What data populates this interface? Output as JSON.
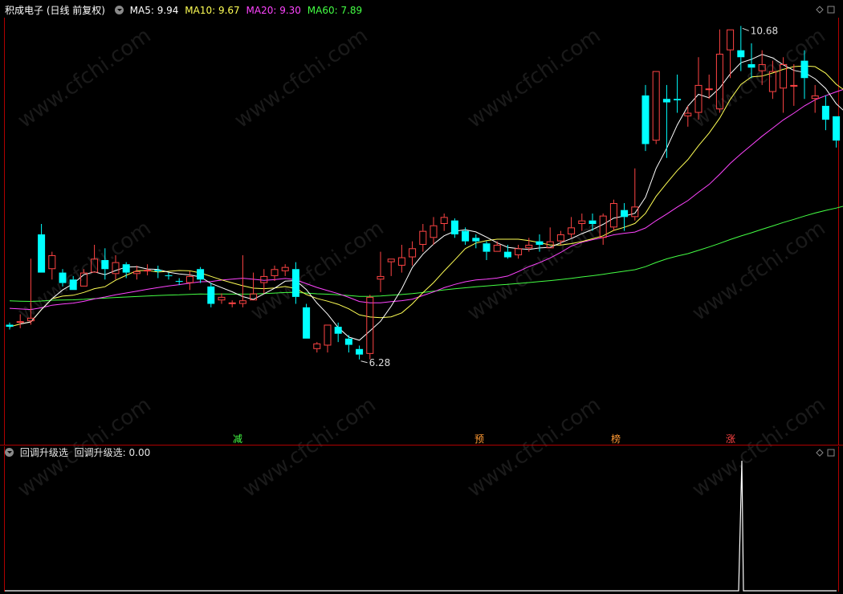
{
  "header": {
    "stock_title": "积成电子 (日线 前复权)",
    "ma5": {
      "label": "MA5: 9.94",
      "color": "#ffffff"
    },
    "ma10": {
      "label": "MA10: 9.67",
      "color": "#ffff55"
    },
    "ma20": {
      "label": "MA20: 9.30",
      "color": "#ff44ff"
    },
    "ma60": {
      "label": "MA60: 7.89",
      "color": "#44ff44"
    }
  },
  "indicator_panel": {
    "title": "回调升级选",
    "value_label": "回调升级选: 0.00"
  },
  "signals": [
    {
      "text": "减",
      "color": "#44ff44"
    },
    {
      "text": "预",
      "color": "#ff9933"
    },
    {
      "text": "榜",
      "color": "#ff9933"
    },
    {
      "text": "涨",
      "color": "#ff4444"
    }
  ],
  "watermark": "www.cfchi.com",
  "colors": {
    "up": "#ff4444",
    "down": "#00ffff",
    "ma5": "#ffffff",
    "ma10": "#ffff55",
    "ma20": "#ff44ff",
    "ma60": "#44ff44",
    "axis": "#b00000"
  },
  "chart_data": {
    "type": "candlestick",
    "ylim": [
      5.5,
      11.3
    ],
    "annotations": {
      "high_label": "10.68",
      "low_label": "6.28"
    },
    "candles": [
      [
        6.95,
        6.92,
        6.88,
        6.98
      ],
      [
        6.99,
        7.0,
        6.9,
        7.1
      ],
      [
        7.0,
        7.05,
        6.95,
        7.9
      ],
      [
        8.25,
        7.7,
        7.7,
        8.4
      ],
      [
        7.75,
        7.95,
        7.6,
        8.0
      ],
      [
        7.7,
        7.55,
        7.5,
        7.75
      ],
      [
        7.6,
        7.45,
        7.45,
        7.65
      ],
      [
        7.5,
        7.7,
        7.5,
        7.75
      ],
      [
        7.7,
        7.9,
        7.7,
        8.1
      ],
      [
        7.88,
        7.75,
        7.6,
        8.05
      ],
      [
        7.68,
        7.85,
        7.6,
        7.95
      ],
      [
        7.82,
        7.7,
        7.62,
        7.85
      ],
      [
        7.68,
        7.72,
        7.6,
        7.8
      ],
      [
        7.72,
        7.74,
        7.66,
        7.82
      ],
      [
        7.74,
        7.72,
        7.62,
        7.8
      ],
      [
        7.66,
        7.65,
        7.6,
        7.7
      ],
      [
        7.58,
        7.57,
        7.52,
        7.62
      ],
      [
        7.55,
        7.65,
        7.45,
        7.72
      ],
      [
        7.75,
        7.6,
        7.55,
        7.78
      ],
      [
        7.5,
        7.25,
        7.2,
        7.55
      ],
      [
        7.3,
        7.35,
        7.25,
        7.4
      ],
      [
        7.25,
        7.27,
        7.2,
        7.3
      ],
      [
        7.25,
        7.3,
        7.2,
        7.95
      ],
      [
        7.3,
        7.4,
        7.3,
        7.7
      ],
      [
        7.55,
        7.65,
        7.4,
        7.75
      ],
      [
        7.65,
        7.75,
        7.58,
        7.8
      ],
      [
        7.72,
        7.78,
        7.65,
        7.82
      ],
      [
        7.75,
        7.35,
        7.25,
        7.85
      ],
      [
        7.2,
        6.75,
        6.75,
        7.25
      ],
      [
        6.6,
        6.68,
        6.55,
        6.7
      ],
      [
        6.65,
        6.95,
        6.55,
        6.95
      ],
      [
        6.92,
        6.82,
        6.7,
        6.98
      ],
      [
        6.75,
        6.66,
        6.55,
        6.8
      ],
      [
        6.6,
        6.52,
        6.45,
        6.65
      ],
      [
        6.53,
        7.35,
        6.45,
        7.38
      ],
      [
        7.6,
        7.65,
        7.42,
        8.0
      ],
      [
        7.85,
        7.9,
        7.65,
        7.9
      ],
      [
        7.8,
        7.92,
        7.7,
        8.1
      ],
      [
        7.92,
        8.05,
        7.8,
        8.15
      ],
      [
        8.1,
        8.3,
        8.0,
        8.4
      ],
      [
        8.2,
        8.38,
        8.1,
        8.5
      ],
      [
        8.4,
        8.5,
        8.3,
        8.55
      ],
      [
        8.45,
        8.25,
        8.2,
        8.48
      ],
      [
        8.3,
        8.15,
        8.1,
        8.35
      ],
      [
        8.2,
        8.15,
        8.05,
        8.25
      ],
      [
        8.12,
        8.0,
        7.88,
        8.15
      ],
      [
        8.0,
        8.1,
        8.0,
        8.15
      ],
      [
        8.0,
        7.92,
        7.9,
        8.1
      ],
      [
        7.95,
        8.05,
        7.9,
        8.1
      ],
      [
        8.05,
        8.1,
        8.0,
        8.2
      ],
      [
        8.15,
        8.1,
        8.0,
        8.25
      ],
      [
        8.05,
        8.15,
        8.05,
        8.35
      ],
      [
        8.15,
        8.25,
        8.1,
        8.3
      ],
      [
        8.25,
        8.35,
        8.2,
        8.5
      ],
      [
        8.4,
        8.45,
        8.3,
        8.55
      ],
      [
        8.45,
        8.4,
        8.3,
        8.55
      ],
      [
        8.2,
        8.52,
        8.1,
        8.55
      ],
      [
        8.35,
        8.7,
        8.3,
        8.75
      ],
      [
        8.6,
        8.5,
        8.3,
        8.7
      ],
      [
        8.5,
        8.65,
        8.45,
        9.2
      ],
      [
        10.25,
        9.55,
        9.45,
        10.4
      ],
      [
        9.6,
        10.6,
        9.55,
        10.6
      ],
      [
        10.2,
        10.15,
        9.35,
        10.4
      ],
      [
        10.2,
        10.18,
        10.0,
        10.55
      ],
      [
        9.95,
        10.0,
        9.8,
        10.1
      ],
      [
        10.0,
        10.4,
        9.9,
        10.8
      ],
      [
        10.35,
        10.35,
        10.2,
        10.55
      ],
      [
        10.05,
        10.85,
        10.0,
        11.2
      ],
      [
        10.9,
        11.2,
        10.5,
        11.2
      ],
      [
        10.9,
        10.8,
        10.6,
        11.25
      ],
      [
        10.7,
        10.65,
        10.5,
        11.0
      ],
      [
        10.6,
        10.7,
        10.4,
        10.9
      ],
      [
        10.3,
        10.6,
        10.2,
        10.75
      ],
      [
        10.35,
        10.7,
        10.0,
        10.8
      ],
      [
        10.4,
        10.4,
        10.1,
        10.7
      ],
      [
        10.75,
        10.5,
        10.2,
        10.9
      ],
      [
        10.2,
        10.25,
        10.0,
        10.4
      ],
      [
        10.1,
        9.9,
        9.75,
        10.25
      ],
      [
        9.95,
        9.6,
        9.5,
        9.95
      ],
      [
        9.55,
        9.7,
        9.55,
        10.1
      ]
    ],
    "indicator": {
      "type": "line",
      "values": [
        0,
        0,
        0,
        0,
        0,
        0,
        1,
        0,
        0
      ],
      "ylim": [
        0,
        1
      ]
    }
  }
}
